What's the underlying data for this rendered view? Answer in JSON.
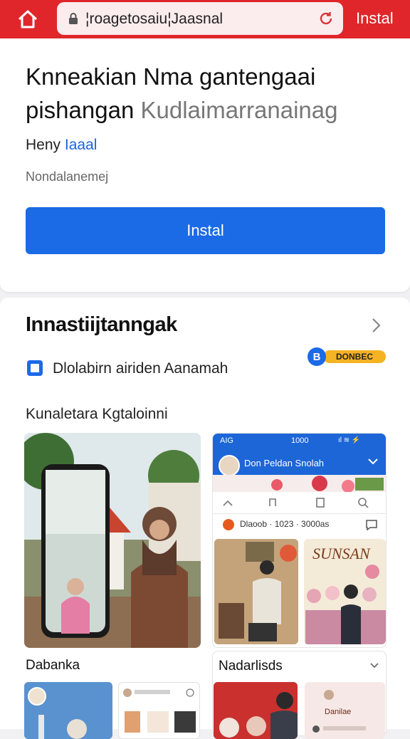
{
  "browser": {
    "url": "¦roagetosaiu¦Jaasnal",
    "install_label": "Instal",
    "home_icon": "home-icon",
    "lock_icon": "lock-icon",
    "reload_icon": "reload-icon",
    "bar_color": "#e0262a"
  },
  "app": {
    "title_main": "Knneakian Nma gantengaai pishangan",
    "title_muted": "Kudlaimarranainag",
    "developer_label": "Heny",
    "developer_link": "Iaaal",
    "subtitle": "Nondalanemej",
    "install_button": "Instal",
    "accent_color": "#1b6ae6"
  },
  "details": {
    "section_title": "Innastiijtanngak",
    "badge_letter": "B",
    "badge_text": "DONBEC",
    "row_text": "Dlolabirn airiden Aanamah",
    "screenshots_label": "Kunaletara Kgtaloinni"
  },
  "app_screen": {
    "status_left": "AIG",
    "status_time": "1000",
    "status_icons": "ıl ≋ ⚡",
    "header_title": "Don Peldan Snolah",
    "info_text": "Dlaoob · 1023 · 3000as",
    "photo2_text": "SUNSAN"
  },
  "lower": {
    "label_left": "Dabanka",
    "label_right": "Nadarlisds",
    "thumb_text": "Danilae"
  }
}
